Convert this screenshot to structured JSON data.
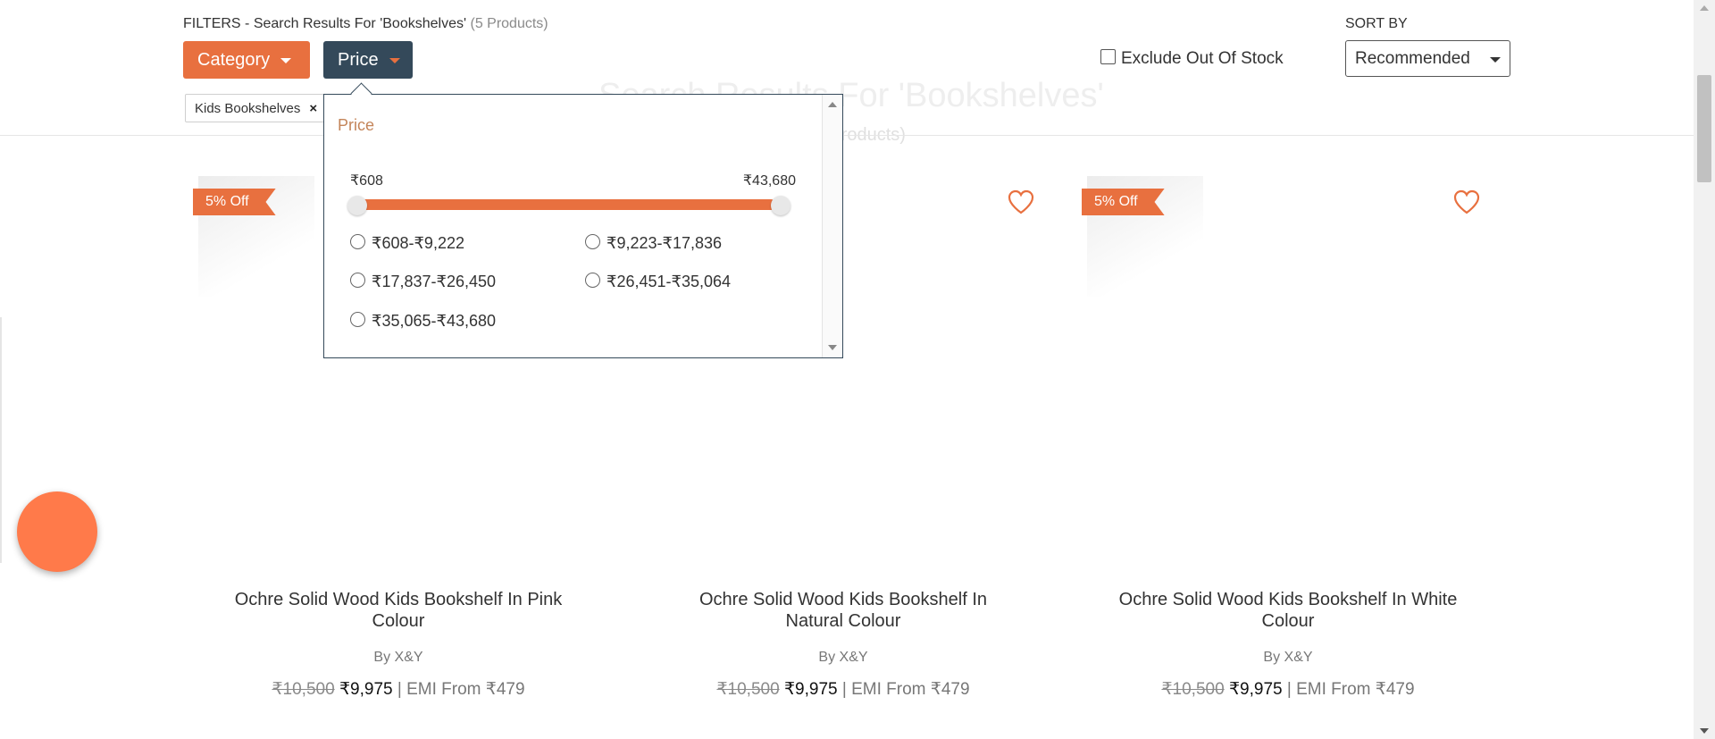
{
  "filters": {
    "heading": "FILTERS - Search Results For 'Bookshelves'",
    "count": "(5 Products)",
    "category_label": "Category",
    "price_label": "Price",
    "chip_label": "Kids Bookshelves",
    "chip_remove": "×",
    "exclude_label": "Exclude Out Of Stock"
  },
  "sort": {
    "label": "SORT BY",
    "selected": "Recommended"
  },
  "background": {
    "title": "Search Results For 'Bookshelves'",
    "subtitle": "(5 Products)"
  },
  "price_dropdown": {
    "title": "Price",
    "min": "₹608",
    "max": "₹43,680",
    "range_low_fraction": 0,
    "range_high_fraction": 1,
    "options": [
      "₹608-₹9,222",
      "₹9,223-₹17,836",
      "₹17,837-₹26,450",
      "₹26,451-₹35,064",
      "₹35,065-₹43,680"
    ]
  },
  "products": [
    {
      "badge": "5% Off",
      "title_line1": "Ochre Solid Wood Kids Bookshelf In Pink",
      "title_line2": "Colour",
      "brand": "By X&Y",
      "mrp": "₹10,500",
      "price": "₹9,975",
      "emi": "| EMI From ₹479"
    },
    {
      "badge": "",
      "title_line1": "Ochre Solid Wood Kids Bookshelf In",
      "title_line2": "Natural Colour",
      "brand": "By X&Y",
      "mrp": "₹10,500",
      "price": "₹9,975",
      "emi": "| EMI From ₹479"
    },
    {
      "badge": "5% Off",
      "title_line1": "Ochre Solid Wood Kids Bookshelf In White",
      "title_line2": "Colour",
      "brand": "By X&Y",
      "mrp": "₹10,500",
      "price": "₹9,975",
      "emi": "| EMI From ₹479"
    }
  ],
  "colors": {
    "accent": "#e8703f",
    "dark_button": "#34495a",
    "chat_bubble": "#ff7a4a"
  },
  "icons": [
    "chevron-down-icon",
    "close-icon",
    "heart-icon",
    "chat-bubble-icon"
  ]
}
